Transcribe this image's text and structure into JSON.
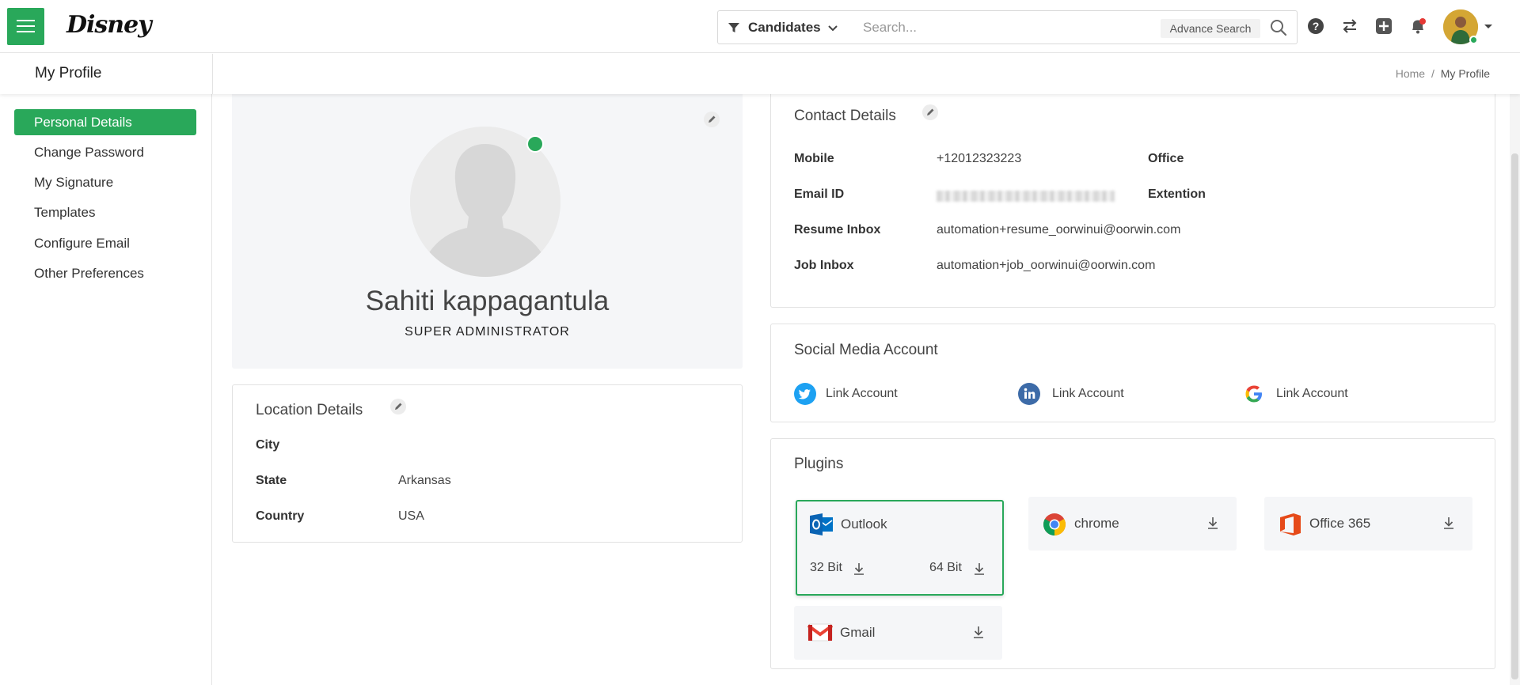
{
  "app": {
    "logo_text": "Disney"
  },
  "header": {
    "filter_label": "Candidates",
    "search_placeholder": "Search...",
    "advance_search": "Advance Search",
    "icons": [
      "help-icon",
      "switch-icon",
      "add-icon",
      "bell-icon",
      "user-avatar"
    ],
    "accent_color": "#29a85a"
  },
  "subheader": {
    "title": "My Profile",
    "breadcrumb": {
      "home": "Home",
      "separator": "/",
      "current": "My Profile"
    }
  },
  "sidebar": {
    "items": [
      {
        "label": "Personal Details",
        "active": true
      },
      {
        "label": "Change Password",
        "active": false
      },
      {
        "label": "My Signature",
        "active": false
      },
      {
        "label": "Templates",
        "active": false
      },
      {
        "label": "Configure Email",
        "active": false
      },
      {
        "label": "Other Preferences",
        "active": false
      }
    ]
  },
  "profile": {
    "name": "Sahiti kappagantula",
    "role": "SUPER ADMINISTRATOR",
    "status": "online"
  },
  "location": {
    "title": "Location Details",
    "fields": [
      {
        "label": "City",
        "value": ""
      },
      {
        "label": "State",
        "value": "Arkansas"
      },
      {
        "label": "Country",
        "value": "USA"
      }
    ]
  },
  "contact": {
    "title": "Contact Details",
    "mobile_label": "Mobile",
    "mobile_value": "+12012323223",
    "office_label": "Office",
    "email_label": "Email ID",
    "extention_label": "Extention",
    "resume_inbox_label": "Resume Inbox",
    "resume_inbox_value": "automation+resume_oorwinui@oorwin.com",
    "job_inbox_label": "Job Inbox",
    "job_inbox_value": "automation+job_oorwinui@oorwin.com"
  },
  "social": {
    "title": "Social Media Account",
    "links": [
      {
        "network": "twitter",
        "label": "Link Account",
        "color": "#1da1f2"
      },
      {
        "network": "linkedin",
        "label": "Link Account",
        "color": "#3d6ba8"
      },
      {
        "network": "google",
        "label": "Link Account",
        "color": "#4285f4"
      }
    ]
  },
  "plugins": {
    "title": "Plugins",
    "outlook": {
      "name": "Outlook",
      "bit32": "32 Bit",
      "bit64": "64 Bit"
    },
    "chrome": {
      "name": "chrome"
    },
    "office365": {
      "name": "Office 365"
    },
    "gmail": {
      "name": "Gmail"
    }
  }
}
